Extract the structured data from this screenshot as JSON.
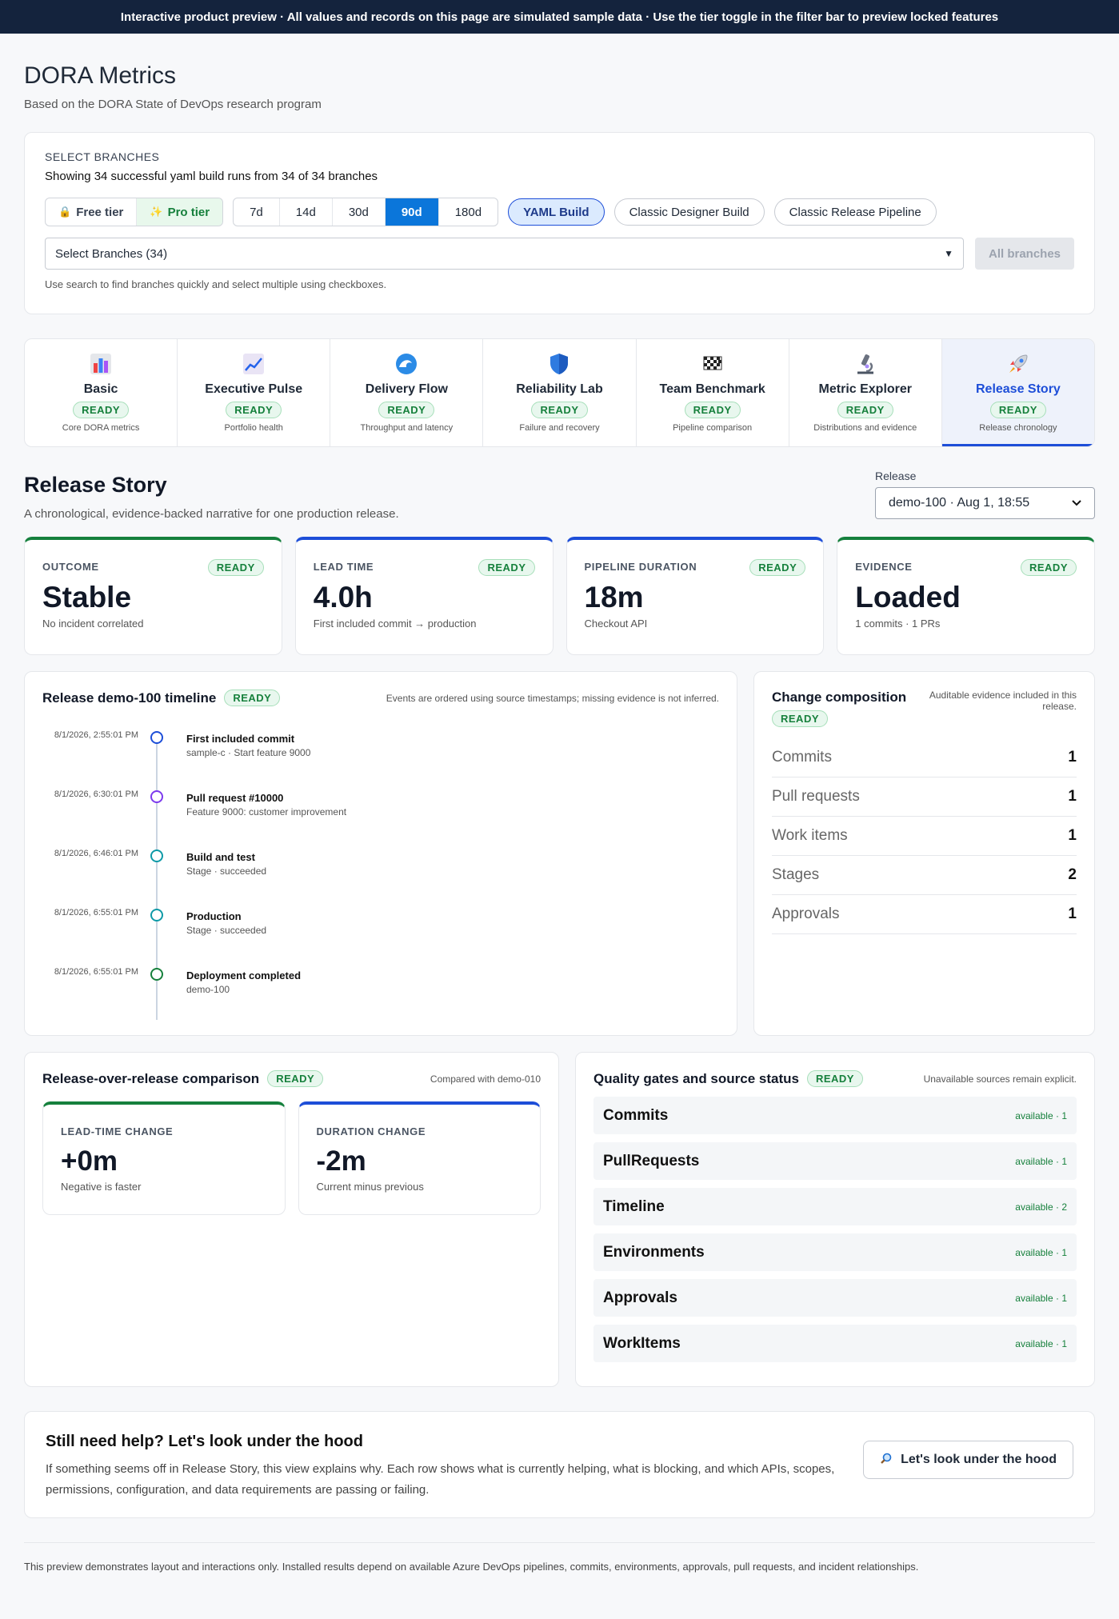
{
  "banner": "Interactive product preview · All values and records on this page are simulated sample data · Use the tier toggle in the filter bar to preview locked features",
  "page": {
    "title": "DORA Metrics",
    "subtitle": "Based on the DORA State of DevOps research program"
  },
  "branches": {
    "section_label": "SELECT BRANCHES",
    "showing": "Showing 34 successful yaml build runs from 34 of 34 branches",
    "tiers": [
      "Free tier",
      "Pro tier"
    ],
    "ranges": [
      "7d",
      "14d",
      "30d",
      "90d",
      "180d"
    ],
    "active_range": "90d",
    "sources": [
      "YAML Build",
      "Classic Designer Build",
      "Classic Release Pipeline"
    ],
    "active_source": "YAML Build",
    "select_value": "Select Branches (34)",
    "all_branches": "All branches",
    "hint": "Use search to find branches quickly and select multiple using checkboxes."
  },
  "tabs": [
    {
      "name": "Basic",
      "status": "READY",
      "desc": "Core DORA metrics",
      "icon": "bar-chart-icon"
    },
    {
      "name": "Executive Pulse",
      "status": "READY",
      "desc": "Portfolio health",
      "icon": "trend-chart-icon"
    },
    {
      "name": "Delivery Flow",
      "status": "READY",
      "desc": "Throughput and latency",
      "icon": "wave-icon"
    },
    {
      "name": "Reliability Lab",
      "status": "READY",
      "desc": "Failure and recovery",
      "icon": "shield-icon"
    },
    {
      "name": "Team Benchmark",
      "status": "READY",
      "desc": "Pipeline comparison",
      "icon": "checkered-flag-icon"
    },
    {
      "name": "Metric Explorer",
      "status": "READY",
      "desc": "Distributions and evidence",
      "icon": "microscope-icon"
    },
    {
      "name": "Release Story",
      "status": "READY",
      "desc": "Release chronology",
      "icon": "rocket-icon"
    }
  ],
  "release_story": {
    "title": "Release Story",
    "subtitle": "A chronological, evidence-backed narrative for one production release.",
    "release_label": "Release",
    "release_value": "demo-100 · Aug 1, 18:55"
  },
  "kpis": [
    {
      "label": "OUTCOME",
      "status": "READY",
      "value": "Stable",
      "sub": "No incident correlated"
    },
    {
      "label": "LEAD TIME",
      "status": "READY",
      "value": "4.0h",
      "sub": "First included commit → production"
    },
    {
      "label": "PIPELINE DURATION",
      "status": "READY",
      "value": "18m",
      "sub": "Checkout API"
    },
    {
      "label": "EVIDENCE",
      "status": "READY",
      "value": "Loaded",
      "sub": "1 commits · 1 PRs"
    }
  ],
  "timeline": {
    "title": "Release demo-100 timeline",
    "status": "READY",
    "note": "Events are ordered using source timestamps; missing evidence is not inferred.",
    "events": [
      {
        "time": "8/1/2026, 2:55:01 PM",
        "name": "First included commit",
        "meta": "sample-c · Start feature 9000",
        "color": "#1d4ed8"
      },
      {
        "time": "8/1/2026, 6:30:01 PM",
        "name": "Pull request #10000",
        "meta": "Feature 9000: customer improvement",
        "color": "#7c3aed"
      },
      {
        "time": "8/1/2026, 6:46:01 PM",
        "name": "Build and test",
        "meta": "Stage · succeeded",
        "color": "#0e9aa7"
      },
      {
        "time": "8/1/2026, 6:55:01 PM",
        "name": "Production",
        "meta": "Stage · succeeded",
        "color": "#0e9aa7"
      },
      {
        "time": "8/1/2026, 6:55:01 PM",
        "name": "Deployment completed",
        "meta": "demo-100",
        "color": "#16803c"
      }
    ]
  },
  "composition": {
    "title": "Change composition",
    "status": "READY",
    "note": "Auditable evidence included in this release.",
    "rows": [
      {
        "label": "Commits",
        "value": "1"
      },
      {
        "label": "Pull requests",
        "value": "1"
      },
      {
        "label": "Work items",
        "value": "1"
      },
      {
        "label": "Stages",
        "value": "2"
      },
      {
        "label": "Approvals",
        "value": "1"
      }
    ]
  },
  "comparison": {
    "title": "Release-over-release comparison",
    "status": "READY",
    "note": "Compared with demo-010",
    "deltas": [
      {
        "label": "LEAD-TIME CHANGE",
        "value": "+0m",
        "sub": "Negative is faster"
      },
      {
        "label": "DURATION CHANGE",
        "value": "-2m",
        "sub": "Current minus previous"
      }
    ]
  },
  "quality": {
    "title": "Quality gates and source status",
    "status": "READY",
    "note": "Unavailable sources remain explicit.",
    "rows": [
      {
        "name": "Commits",
        "status": "available · 1"
      },
      {
        "name": "PullRequests",
        "status": "available · 1"
      },
      {
        "name": "Timeline",
        "status": "available · 2"
      },
      {
        "name": "Environments",
        "status": "available · 1"
      },
      {
        "name": "Approvals",
        "status": "available · 1"
      },
      {
        "name": "WorkItems",
        "status": "available · 1"
      }
    ]
  },
  "help": {
    "title": "Still need help? Let's look under the hood",
    "text": "If something seems off in Release Story, this view explains why. Each row shows what is currently helping, what is blocking, and which APIs, scopes, permissions, configuration, and data requirements are passing or failing.",
    "button": "Let's look under the hood"
  },
  "footer": "This preview demonstrates layout and interactions only. Installed results depend on available Azure DevOps pipelines, commits, environments, approvals, pull requests, and incident relationships."
}
